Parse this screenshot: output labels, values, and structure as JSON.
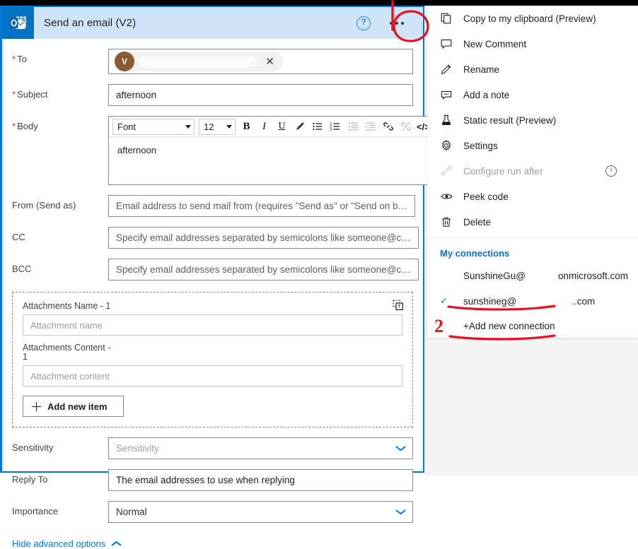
{
  "card": {
    "title": "Send an email (V2)",
    "app_icon": "outlook-icon",
    "help_icon": "help-icon",
    "more_icon": "ellipsis-icon"
  },
  "form": {
    "to": {
      "label": "To",
      "required": true,
      "chip_initial": "V",
      "chip_remove_icon": "close-icon"
    },
    "subject": {
      "label": "Subject",
      "required": true,
      "value": "afternoon"
    },
    "body": {
      "label": "Body",
      "required": true,
      "value": "afternoon",
      "toolbar": {
        "font_name": "Font",
        "font_size": "12",
        "buttons": [
          {
            "name": "bold-icon",
            "glyph": "B",
            "disabled": false
          },
          {
            "name": "italic-icon",
            "glyph": "I",
            "disabled": false
          },
          {
            "name": "underline-icon",
            "glyph": "U",
            "disabled": false
          },
          {
            "name": "text-color-icon",
            "glyph": "pen",
            "disabled": false
          },
          {
            "name": "bulleted-list-icon",
            "glyph": "ul",
            "disabled": false
          },
          {
            "name": "numbered-list-icon",
            "glyph": "ol",
            "disabled": false
          },
          {
            "name": "decrease-indent-icon",
            "glyph": "outdent",
            "disabled": true
          },
          {
            "name": "increase-indent-icon",
            "glyph": "indent",
            "disabled": true
          },
          {
            "name": "insert-link-icon",
            "glyph": "link",
            "disabled": false
          },
          {
            "name": "remove-link-icon",
            "glyph": "unlink",
            "disabled": true
          },
          {
            "name": "code-view-icon",
            "glyph": "</>",
            "disabled": false
          }
        ]
      }
    },
    "from": {
      "label": "From (Send as)",
      "placeholder": "Email address to send mail from (requires \"Send as\" or \"Send on b…"
    },
    "cc": {
      "label": "CC",
      "placeholder": "Specify email addresses separated by semicolons like someone@c…"
    },
    "bcc": {
      "label": "BCC",
      "placeholder": "Specify email addresses separated by semicolons like someone@c…"
    },
    "attachments": {
      "name_label": "Attachments Name - 1",
      "name_placeholder": "Attachment name",
      "content_label": "Attachments Content -",
      "content_label_index": "1",
      "content_placeholder": "Attachment content",
      "add_button": "Add new item",
      "add_icon": "plus-icon",
      "copy_icon": "copy-as-text-icon"
    },
    "sensitivity": {
      "label": "Sensitivity",
      "placeholder": "Sensitivity",
      "chevron_icon": "chevron-down-icon"
    },
    "reply_to": {
      "label": "Reply To",
      "placeholder": "The email addresses to use when replying"
    },
    "importance": {
      "label": "Importance",
      "value": "Normal",
      "chevron_icon": "chevron-down-icon"
    },
    "hide_advanced": {
      "label": "Hide advanced options",
      "chevron_icon": "chevron-up-icon"
    }
  },
  "menu": {
    "items": [
      {
        "label": "Copy to my clipboard (Preview)",
        "icon": "copy-icon",
        "disabled": false,
        "info": false
      },
      {
        "label": "New Comment",
        "icon": "comment-icon",
        "disabled": false,
        "info": false
      },
      {
        "label": "Rename",
        "icon": "pencil-icon",
        "disabled": false,
        "info": false
      },
      {
        "label": "Add a note",
        "icon": "note-icon",
        "disabled": false,
        "info": false
      },
      {
        "label": "Static result (Preview)",
        "icon": "flask-icon",
        "disabled": false,
        "info": false
      },
      {
        "label": "Settings",
        "icon": "gear-icon",
        "disabled": false,
        "info": false
      },
      {
        "label": "Configure run after",
        "icon": "run-after-icon",
        "disabled": true,
        "info": true
      },
      {
        "label": "Peek code",
        "icon": "eye-icon",
        "disabled": false,
        "info": false
      },
      {
        "label": "Delete",
        "icon": "trash-icon",
        "disabled": false,
        "info": false
      }
    ],
    "connections": {
      "header": "My connections",
      "items": [
        {
          "name": "SunshineGu@",
          "domain": "onmicrosoft.com",
          "checked": false
        },
        {
          "name": "sunshineg@",
          "domain": "..com",
          "checked": true
        }
      ],
      "add_label": "+Add new connection"
    }
  },
  "annotations": {
    "step_2_label": "2",
    "color": "#e81123"
  },
  "colors": {
    "accent": "#0078d4",
    "header_bg": "#cfe4f7",
    "app_tile": "#0072c6",
    "link": "#0b6ecf",
    "required": "#c4413e",
    "annotation_red": "#e81123",
    "backdrop": "#f4f4f4"
  }
}
